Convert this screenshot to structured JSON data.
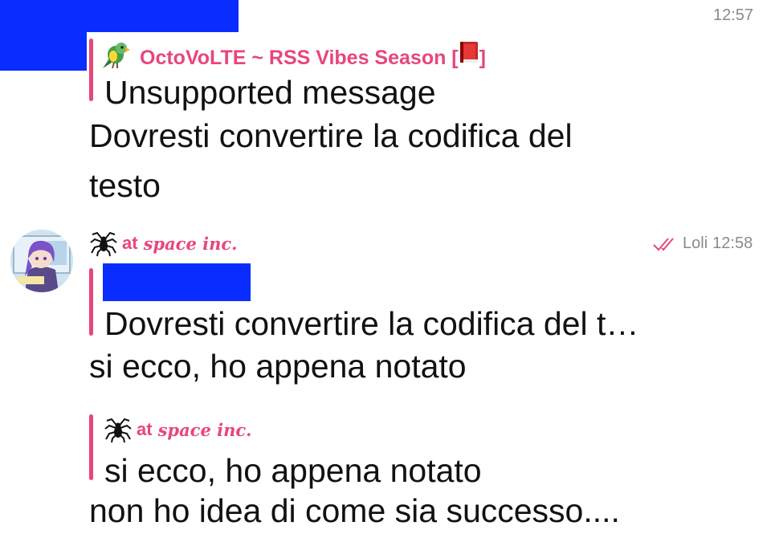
{
  "colors": {
    "accent": "#e8457e",
    "redaction": "#0a2dff",
    "meta_gray": "#8a8a8a",
    "text": "#111111"
  },
  "message1": {
    "time": "12:57",
    "reply": {
      "author_icon": "parrot-icon",
      "author": "OctoVoLTE ~ RSS Vibes Season [",
      "author_suffix_icon": "book-icon",
      "author_close": "]",
      "quoted_text": "Unsupported message"
    },
    "lines": [
      "Dovresti convertire la codifica del",
      "testo"
    ]
  },
  "message2": {
    "sender_icon": "spider-icon",
    "sender_at": "at",
    "sender_name": "space inc.",
    "status_icon": "double-check-icon",
    "edited_by": "Loli",
    "time": "12:58",
    "reply": {
      "quoted_text": "Dovresti convertire la codifica del t…"
    },
    "lines": [
      "si ecco, ho appena notato"
    ]
  },
  "message3": {
    "reply": {
      "author_icon": "spider-icon",
      "author_at": "at",
      "author_name": "space inc.",
      "quoted_text": "si ecco, ho appena notato"
    },
    "lines": [
      "non ho idea di come sia successo...."
    ]
  }
}
